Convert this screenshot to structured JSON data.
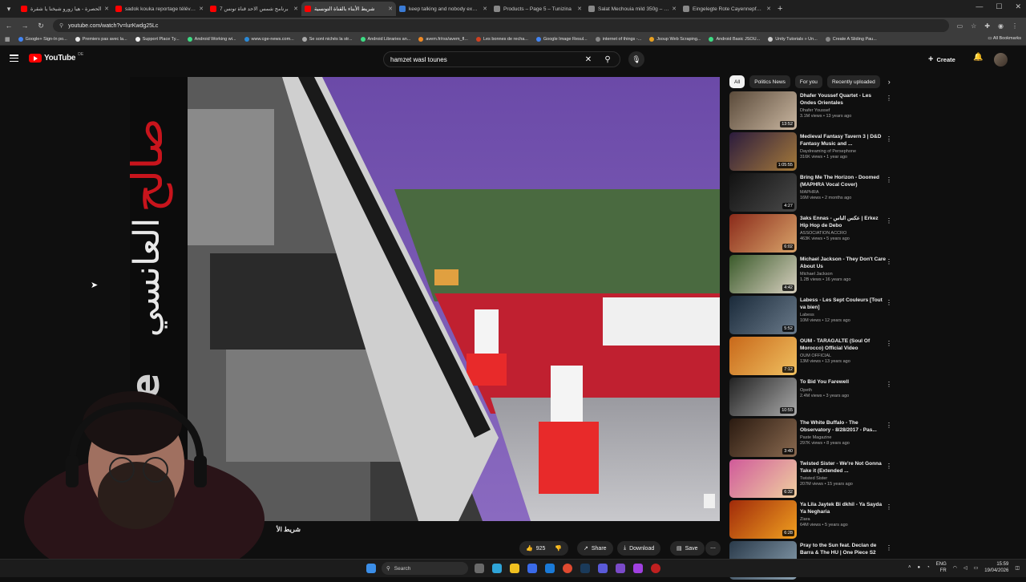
{
  "browser": {
    "tabs": [
      {
        "title": "الحصرة - هيا زورو شيخنا يا شقرة",
        "color": "#ff0000",
        "active": false
      },
      {
        "title": "sadok kouka reportage télévisé",
        "color": "#ff0000",
        "active": false
      },
      {
        "title": "برنامج شمس الاحد قناة تونس 7",
        "color": "#ff0000",
        "active": false
      },
      {
        "title": "شريط الأبناء بالقناة التونسية",
        "color": "#ff0000",
        "active": true
      },
      {
        "title": "keep talking and nobody explodes",
        "color": "#3a7bd5",
        "active": false
      },
      {
        "title": "Products – Page 5 – Tunizina",
        "color": "#888888",
        "active": false
      },
      {
        "title": "Salat Mechouia mild 350g – Co",
        "color": "#888888",
        "active": false
      },
      {
        "title": "Eingelegte Rote Cayennepfeffer",
        "color": "#888888",
        "active": false
      }
    ],
    "url": "youtube.com/watch?v=lurKwdg25Lc",
    "bookmarks": [
      "Google+ Sign-In po...",
      "Premiers pas avec la...",
      "Support Place Ty...",
      "Android Working wi...",
      "www.cge-news.com...",
      "Se sont nichés la str...",
      "Android Libraries an...",
      "avem.fr/rss/avem_fl...",
      "Les bonnes de recha...",
      "Google Image Resul...",
      "internet of things -...",
      "Jsoup Web Scraping...",
      "Android Basic JSOU...",
      "Unity Tutorials » Un...",
      "Create A Sliding Pau..."
    ],
    "all_bookmarks": "All Bookmarks"
  },
  "youtube": {
    "logo_text": "YouTube",
    "country": "DE",
    "search_value": "hamzet wasl tounes",
    "create_label": "Create",
    "video_title": "شريط الأ",
    "actions": {
      "likes": "925",
      "share": "Share",
      "download": "Download",
      "save": "Save"
    },
    "chips": [
      "All",
      "Politics News",
      "For you",
      "Recently uploaded"
    ],
    "recommendations": [
      {
        "title": "Dhafer Youssef Quartet - Les Ondes Orientales",
        "channel": "Dhafer Youssef",
        "meta": "3.1M views • 13 years ago",
        "duration": "13:52",
        "c1": "#5a4a3a",
        "c2": "#c9b6a0"
      },
      {
        "title": "Medieval Fantasy Tavern 3 | D&D Fantasy Music and ...",
        "channel": "Daydreaming of Persephone",
        "meta": "316K views • 1 year ago",
        "duration": "1:05:55",
        "c1": "#2b1b3d",
        "c2": "#a57a3a"
      },
      {
        "title": "Bring Me The Horizon - Doomed (MAPHRA Vocal Cover)",
        "channel": "MAPHRA",
        "meta": "16M views • 2 months ago",
        "duration": "4:27",
        "c1": "#111111",
        "c2": "#4a4a4a"
      },
      {
        "title": "3aks Ennas - عكس الناس | Erkez Hip Hop de Debo",
        "channel": "ASSOCIATION ACCRO",
        "meta": "463K views • 5 years ago",
        "duration": "6:02",
        "c1": "#8a2a1a",
        "c2": "#d9a46a"
      },
      {
        "title": "Michael Jackson - They Don't Care About Us",
        "channel": "Michael Jackson",
        "meta": "1.2B views • 16 years ago",
        "duration": "4:42",
        "c1": "#3a5a2a",
        "c2": "#d8d0c0"
      },
      {
        "title": "Labess - Les Sept Couleurs [Tout va bien]",
        "channel": "Labess",
        "meta": "10M views • 12 years ago",
        "duration": "5:52",
        "c1": "#1a2a3a",
        "c2": "#6a7a8a"
      },
      {
        "title": "OUM - TARAGALTE (Soul Of Morocco) Official Video",
        "channel": "OUM OFFICIAL",
        "meta": "13M views • 13 years ago",
        "duration": "7:12",
        "c1": "#c8681a",
        "c2": "#f0c060"
      },
      {
        "title": "To Bid You Farewell",
        "channel": "Opeth",
        "meta": "2.4M views • 3 years ago",
        "duration": "10:55",
        "c1": "#222222",
        "c2": "#aaaaaa"
      },
      {
        "title": "The White Buffalo - The Observatory - 8/28/2017 - Pas...",
        "channel": "Paste Magazine",
        "meta": "297K views • 8 years ago",
        "duration": "3:40",
        "c1": "#2a1a10",
        "c2": "#8a6a50"
      },
      {
        "title": "Twisted Sister - We're Not Gonna Take it (Extended ...",
        "channel": "Twisted Sister",
        "meta": "207M views • 15 years ago",
        "duration": "6:32",
        "c1": "#d05a9a",
        "c2": "#f0d0a0"
      },
      {
        "title": "Ya Lila Jaytek Bi dkhil - Ya Sayda Ya Negharia",
        "channel": "Ziara",
        "meta": "64M views • 5 years ago",
        "duration": "6:28",
        "c1": "#a02a0a",
        "c2": "#f0a020"
      },
      {
        "title": "Pray to the Sun feat. Declan de Barra & The HU | One Piece S2",
        "channel": "",
        "meta": "",
        "duration": "",
        "c1": "#2a3a4a",
        "c2": "#8aa0b0"
      }
    ]
  },
  "taskbar": {
    "search_label": "Search",
    "lang_top": "ENG",
    "lang_bottom": "FR",
    "time": "15:59",
    "date": "19/04/2026"
  }
}
